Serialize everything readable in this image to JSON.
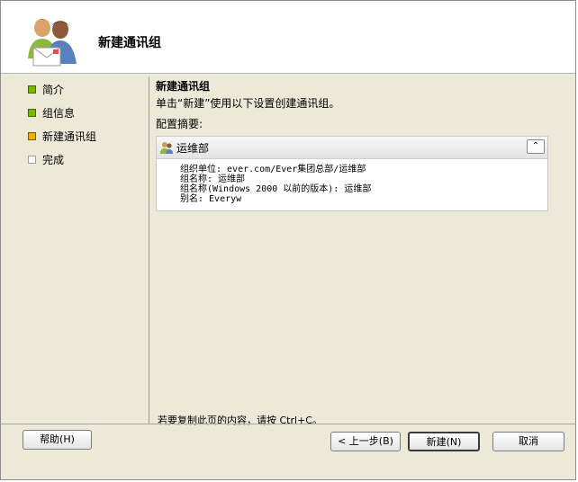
{
  "header": {
    "title": "新建通讯组",
    "icon": "users-mail-icon"
  },
  "nav": {
    "items": [
      {
        "label": "简介",
        "state": "done"
      },
      {
        "label": "组信息",
        "state": "done"
      },
      {
        "label": "新建通讯组",
        "state": "current"
      },
      {
        "label": "完成",
        "state": "todo"
      }
    ]
  },
  "content": {
    "section_title": "新建通讯组",
    "section_desc": "单击“新建”使用以下设置创建通讯组。",
    "summary_label": "配置摘要:",
    "summary": {
      "header": "运维部",
      "collapse_glyph": "⌃",
      "lines": [
        "组织单位: ever.com/Ever集团总部/运维部",
        "组名称: 运维部",
        "组名称(Windows 2000 以前的版本): 运维部",
        "别名: Everyw"
      ]
    },
    "copy_hint": "若要复制此页的内容，请按 Ctrl+C。"
  },
  "buttons": {
    "help": "帮助(H)",
    "back": "< 上一步(B)",
    "next": "新建(N)",
    "cancel": "取消"
  },
  "colors": {
    "done": "#7ab800",
    "current": "#e8b000",
    "todo": "#ffffff"
  }
}
